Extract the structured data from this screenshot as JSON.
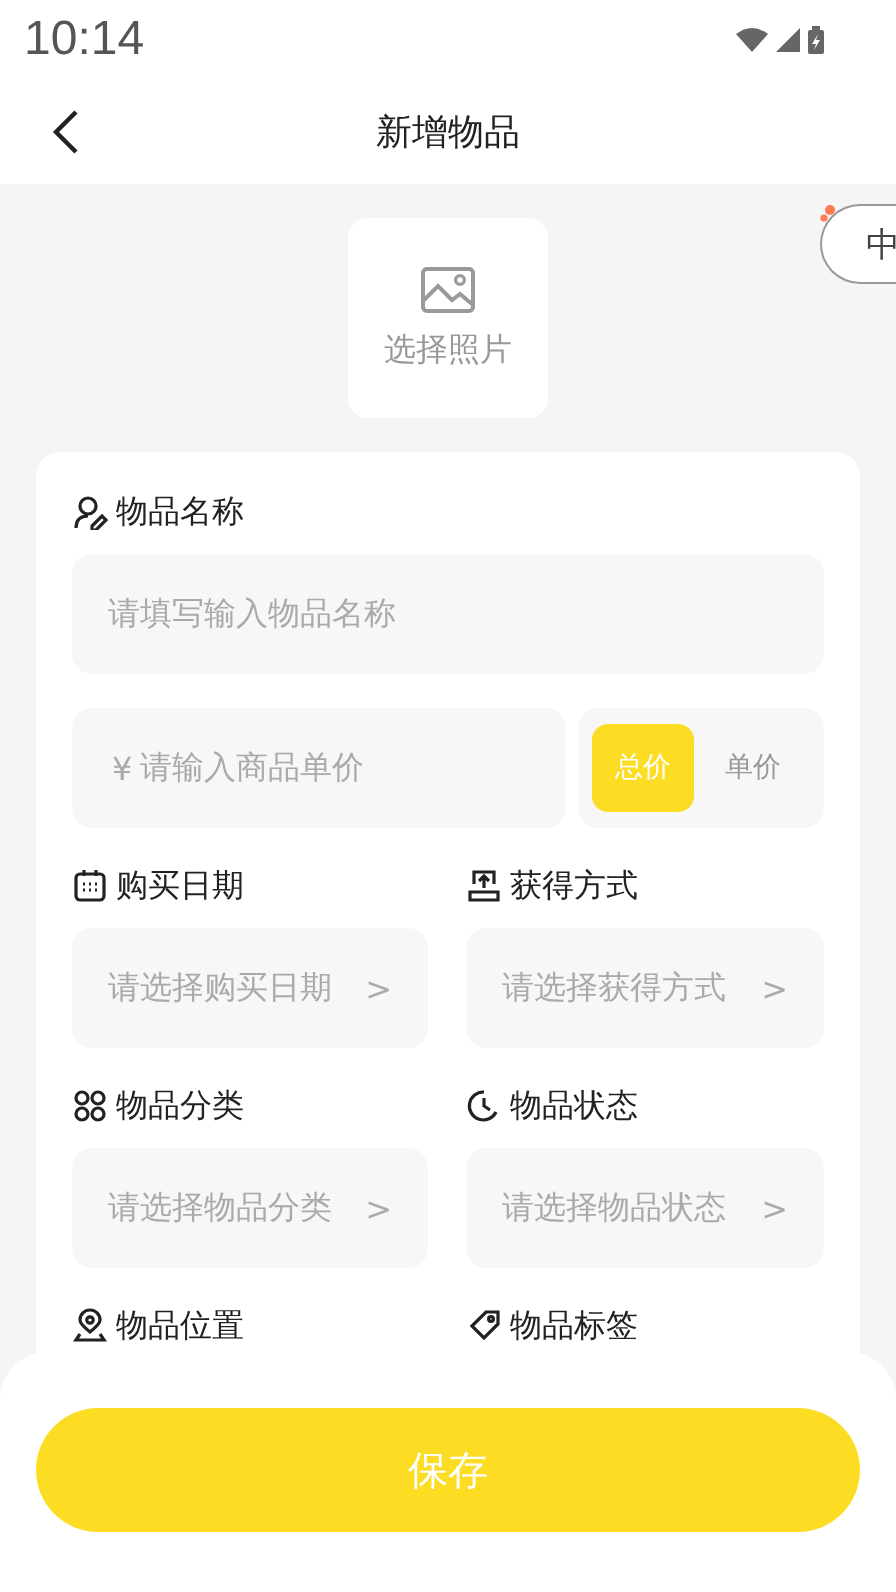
{
  "status_bar": {
    "time": "10:14"
  },
  "header": {
    "title": "新增物品"
  },
  "photo": {
    "label": "选择照片"
  },
  "side_tab": {
    "label": "中"
  },
  "form": {
    "name_field": {
      "label": "物品名称",
      "placeholder": "请填写输入物品名称"
    },
    "price": {
      "currency": "¥",
      "placeholder": "请输入商品单价"
    },
    "price_modes": [
      {
        "label": "总价",
        "selected": true
      },
      {
        "label": "单价",
        "selected": false
      }
    ],
    "selects": [
      {
        "kind": "calendar",
        "label": "购买日期",
        "placeholder": "请选择购买日期",
        "chevron": ">"
      },
      {
        "kind": "upload",
        "label": "获得方式",
        "placeholder": "请选择获得方式",
        "chevron": ">"
      },
      {
        "kind": "grid",
        "label": "物品分类",
        "placeholder": "请选择物品分类",
        "chevron": ">"
      },
      {
        "kind": "clock",
        "label": "物品状态",
        "placeholder": "请选择物品状态",
        "chevron": ">"
      }
    ],
    "more_labels": [
      {
        "kind": "pin",
        "label": "物品位置"
      },
      {
        "kind": "tag",
        "label": "物品标签"
      }
    ]
  },
  "save_button": {
    "label": "保存"
  }
}
